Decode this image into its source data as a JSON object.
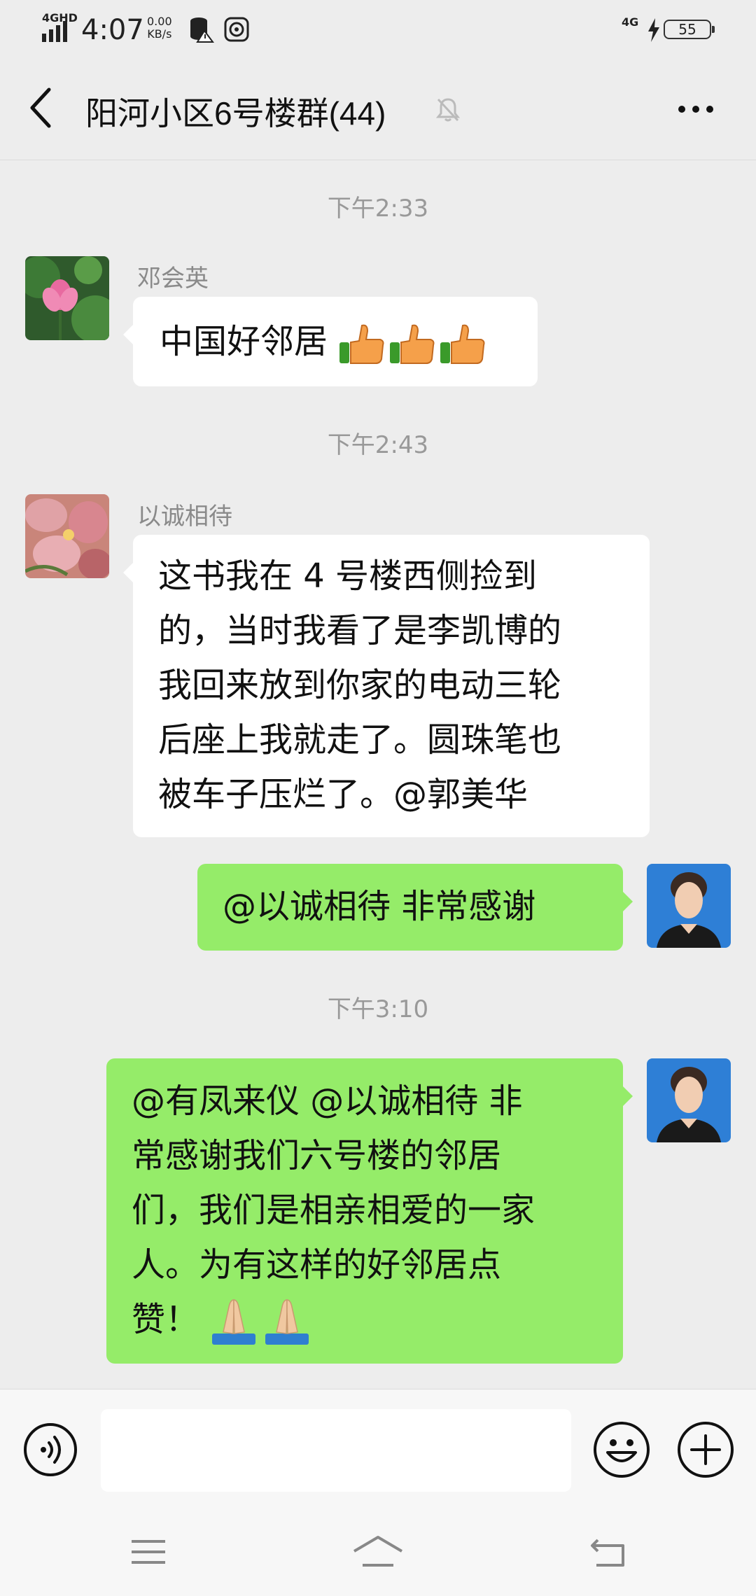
{
  "status_bar": {
    "network_type": "4GHD",
    "time": "4:07",
    "net_speed_value": "0.00",
    "net_speed_unit": "KB/s",
    "mobile_data": "4G",
    "battery": "55"
  },
  "header": {
    "title": "阳河小区6号楼群(44)"
  },
  "messages": [
    {
      "time": "下午2:33"
    },
    {
      "sender": "邓会英",
      "text": "中国好邻居"
    },
    {
      "time": "下午2:43"
    },
    {
      "sender": "以诚相待",
      "lines": [
        "这书我在 4 号楼西侧捡到",
        "的，当时我看了是李凯博的",
        "我回来放到你家的电动三轮",
        "后座上我就走了。圆珠笔也",
        "被车子压烂了。@郭美华"
      ]
    },
    {
      "self": true,
      "text": "@以诚相待  非常感谢"
    },
    {
      "time": "下午3:10"
    },
    {
      "self": true,
      "lines": [
        "@有凤来仪  @以诚相待  非",
        "常感谢我们六号楼的邻居",
        "们，我们是相亲相爱的一家",
        "人。为有这样的好邻居点",
        "赞！"
      ]
    }
  ],
  "colors": {
    "background": "#ededed",
    "self_bubble": "#95ec69",
    "other_bubble": "#ffffff"
  },
  "icons": {
    "back": "chevron-left-icon",
    "mute": "bell-off-icon",
    "more": "more-dots-icon",
    "voice": "voice-icon",
    "emoji": "smiley-icon",
    "plus": "plus-icon",
    "thumbs": "thumbs-up-icon",
    "pray": "folded-hands-icon"
  }
}
